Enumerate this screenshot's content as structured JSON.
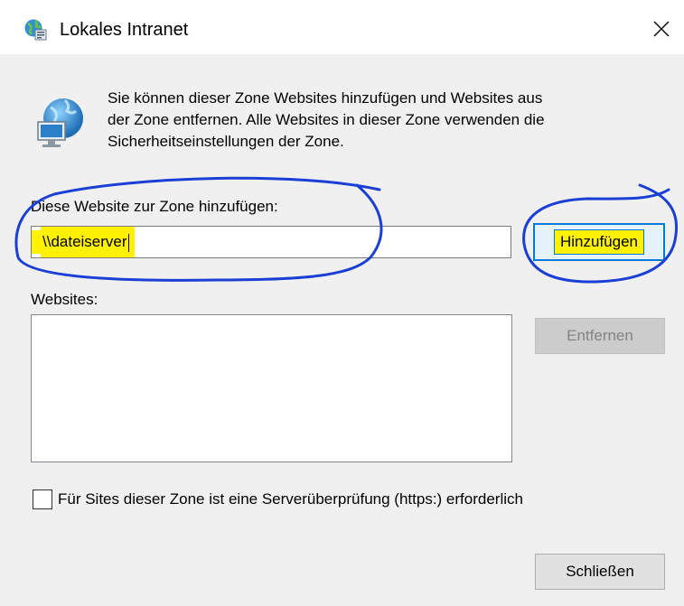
{
  "window": {
    "title": "Lokales Intranet",
    "icon": "intranet-globe-icon",
    "close_icon": "close-icon"
  },
  "description": {
    "lines": [
      "Sie können dieser Zone Websites hinzufügen und Websites aus",
      "der Zone entfernen. Alle Websites in dieser Zone verwenden die",
      "Sicherheitseinstellungen der Zone."
    ],
    "icon": "globe-monitor-icon"
  },
  "add_site": {
    "label": "Diese Website zur Zone hinzufügen:",
    "value": "\\\\dateiserver",
    "button_label": "Hinzufügen"
  },
  "websites": {
    "label": "Websites:",
    "items": [],
    "remove_label": "Entfernen"
  },
  "server_verification": {
    "label": "Für Sites dieser Zone ist eine Serverüberprüfung (https:) erforderlich",
    "checked": false
  },
  "footer": {
    "close_label": "Schließen"
  },
  "colors": {
    "highlight": "#fff200",
    "ink": "#1a3fd6",
    "focus": "#0078d7",
    "dialog_bg": "#f0f0f0"
  }
}
